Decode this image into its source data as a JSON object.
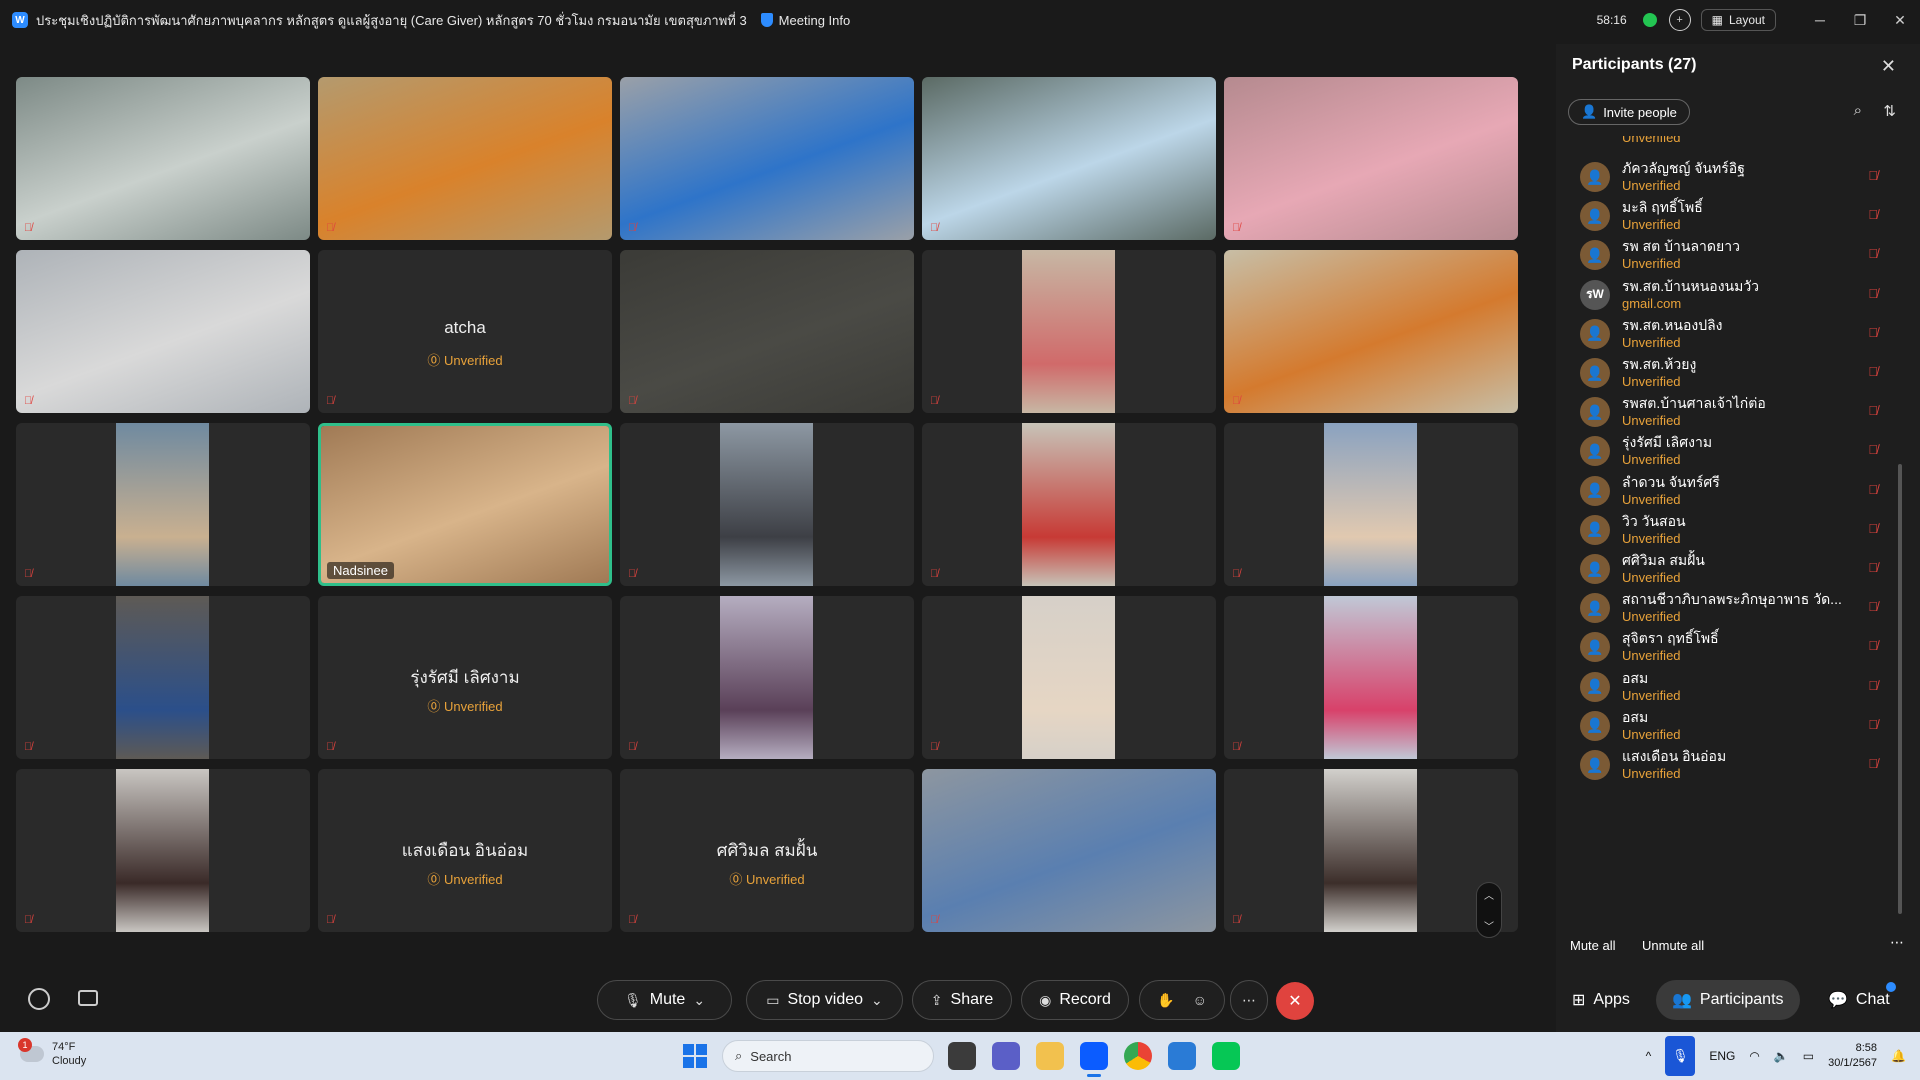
{
  "titlebar": {
    "title": "ประชุมเชิงปฏิบัติการพัฒนาศักยภาพบุคลากร หลักสูตร ดูแลผู้สูงอายุ (Care Giver) หลักสูตร 70 ชั่วโมง กรมอนามัย เขตสุขภาพที่ 3",
    "meeting_info": "Meeting Info",
    "timer": "58:16",
    "layout": "Layout"
  },
  "tiles": [
    {
      "type": "video",
      "bg": "#7d8a86",
      "accent": "#c9d0cc"
    },
    {
      "type": "video",
      "bg": "#b49a6e",
      "accent": "#d9822b"
    },
    {
      "type": "video",
      "bg": "#9aa0a8",
      "accent": "#2e74c9"
    },
    {
      "type": "video",
      "bg": "#5b6a64",
      "accent": "#bcd6e8"
    },
    {
      "type": "video",
      "bg": "#b58a8f",
      "accent": "#e7a8b5"
    },
    {
      "type": "video",
      "bg": "#aeb3b8",
      "accent": "#d9d9d9"
    },
    {
      "type": "name",
      "name": "atcha",
      "status": "Unverified"
    },
    {
      "type": "video",
      "bg": "#3b3b37",
      "accent": "#4a4a45"
    },
    {
      "type": "portrait",
      "bg": "#c7b7a4",
      "accent": "#d06a6a"
    },
    {
      "type": "video",
      "bg": "#c7bea6",
      "accent": "#d47a2e"
    },
    {
      "type": "portrait",
      "bg": "#6f8aa0",
      "accent": "#c9b090"
    },
    {
      "type": "active",
      "bg": "#a07a55",
      "accent": "#d8b48a",
      "name": "Nadsinee"
    },
    {
      "type": "portrait",
      "bg": "#8d98a3",
      "accent": "#3d3f45"
    },
    {
      "type": "portrait",
      "bg": "#c7c3b8",
      "accent": "#c73a35"
    },
    {
      "type": "portrait",
      "bg": "#8aa2c0",
      "accent": "#e1c9b0"
    },
    {
      "type": "portrait",
      "bg": "#5e5a55",
      "accent": "#2b4f8a"
    },
    {
      "type": "name",
      "name": "รุ่งรัศมี เลิศงาม",
      "status": "Unverified"
    },
    {
      "type": "portrait",
      "bg": "#b5adc0",
      "accent": "#5a4058"
    },
    {
      "type": "portrait",
      "bg": "#d6d0c8",
      "accent": "#e6d6c4"
    },
    {
      "type": "portrait",
      "bg": "#c0c8d6",
      "accent": "#d8416a"
    },
    {
      "type": "portrait",
      "bg": "#c9c6c2",
      "accent": "#3a2a28"
    },
    {
      "type": "name",
      "name": "แสงเดือน อินอ่อม",
      "status": "Unverified"
    },
    {
      "type": "name",
      "name": "ศศิวิมล  สมฝั้น",
      "status": "Unverified"
    },
    {
      "type": "video",
      "bg": "#8d96a0",
      "accent": "#5a7fb0"
    },
    {
      "type": "portrait",
      "bg": "#d2d0cc",
      "accent": "#3c2e2a"
    }
  ],
  "panel": {
    "title": "Participants (27)",
    "invite": "Invite people",
    "partial_status": "Unverified",
    "participants": [
      {
        "name": "ภัควลัญชญ์ จันทร์อิฐ",
        "status": "Unverified",
        "avatar": "user"
      },
      {
        "name": "มะลิ ฤทธิ์โพธิ์",
        "status": "Unverified",
        "avatar": "user"
      },
      {
        "name": "รพ สต บ้านลาดยาว",
        "status": "Unverified",
        "avatar": "user"
      },
      {
        "name": "รพ.สต.บ้านหนองนมวัว",
        "status": "gmail.com",
        "avatar": "รW"
      },
      {
        "name": "รพ.สต.หนองปลิง",
        "status": "Unverified",
        "avatar": "user"
      },
      {
        "name": "รพ.สต.ห้วยงู",
        "status": "Unverified",
        "avatar": "user"
      },
      {
        "name": "รพสต.บ้านศาลเจ้าไก่ต่อ",
        "status": "Unverified",
        "avatar": "user"
      },
      {
        "name": "รุ่งรัศมี เลิศงาม",
        "status": "Unverified",
        "avatar": "user"
      },
      {
        "name": "ลำดวน จันทร์ศรี",
        "status": "Unverified",
        "avatar": "user"
      },
      {
        "name": "วิว วันสอน",
        "status": "Unverified",
        "avatar": "user"
      },
      {
        "name": "ศศิวิมล สมฝั้น",
        "status": "Unverified",
        "avatar": "user"
      },
      {
        "name": "สถานชีวาภิบาลพระภิกษุอาพาธ วัด...",
        "status": "Unverified",
        "avatar": "user"
      },
      {
        "name": "สุจิตรา ฤทธิ์โพธิ์",
        "status": "Unverified",
        "avatar": "user"
      },
      {
        "name": "อสม",
        "status": "Unverified",
        "avatar": "user"
      },
      {
        "name": "อสม",
        "status": "Unverified",
        "avatar": "user"
      },
      {
        "name": "แสงเดือน อินอ่อม",
        "status": "Unverified",
        "avatar": "user"
      }
    ],
    "mute_all": "Mute all",
    "unmute_all": "Unmute all"
  },
  "toolbar": {
    "mute": "Mute",
    "stop_video": "Stop video",
    "share": "Share",
    "record": "Record",
    "apps": "Apps",
    "participants": "Participants",
    "chat": "Chat"
  },
  "taskbar": {
    "weather_temp": "74°F",
    "weather_desc": "Cloudy",
    "weather_badge": "1",
    "search": "Search",
    "lang": "ENG",
    "time": "8:58",
    "date": "30/1/2567"
  },
  "colors": {
    "accent": "#2D8CFF",
    "unverified": "#e8a23a",
    "muted": "#e0433e",
    "active_border": "#2fbf8a"
  }
}
